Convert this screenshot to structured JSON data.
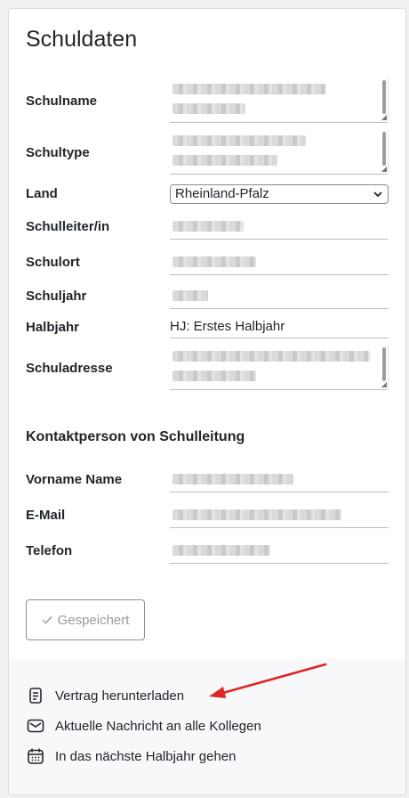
{
  "card": {
    "title": "Schuldaten"
  },
  "fields": {
    "schulname_label": "Schulname",
    "schultype_label": "Schultype",
    "land_label": "Land",
    "land_value": "Rheinland-Pfalz",
    "schulleiter_label": "Schulleiter/in",
    "schulort_label": "Schulort",
    "schuljahr_label": "Schuljahr",
    "halbjahr_label": "Halbjahr",
    "halbjahr_value": "HJ: Erstes Halbjahr",
    "schuladresse_label": "Schuladresse"
  },
  "contact": {
    "section_title": "Kontaktperson von Schulleitung",
    "name_label": "Vorname Name",
    "email_label": "E-Mail",
    "phone_label": "Telefon"
  },
  "save_button": {
    "label": "Gespeichert",
    "icon": "check-icon"
  },
  "actions": [
    {
      "label": "Vertrag herunterladen",
      "icon": "document-icon"
    },
    {
      "label": "Aktuelle Nachricht an alle Kollegen",
      "icon": "envelope-icon"
    },
    {
      "label": "In das nächste Halbjahr gehen",
      "icon": "calendar-icon"
    }
  ],
  "colors": {
    "annotation_arrow": "#e32222"
  }
}
